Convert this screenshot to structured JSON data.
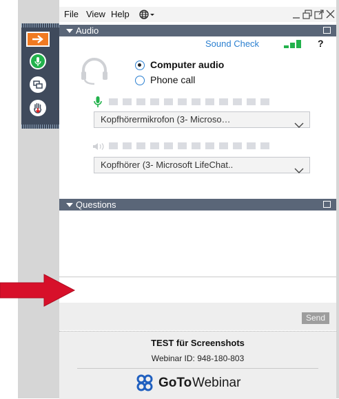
{
  "menubar": {
    "items": [
      "File",
      "View",
      "Help"
    ],
    "window_controls": [
      "minimize",
      "restore",
      "popout",
      "close"
    ]
  },
  "audio": {
    "header": "Audio",
    "sound_check_label": "Sound Check",
    "help_label": "?",
    "options": [
      {
        "label": "Computer audio",
        "selected": true
      },
      {
        "label": "Phone call",
        "selected": false
      }
    ],
    "microphone": {
      "device": "Kopfhörermikrofon (3- Microso…",
      "level_segments_total": 12
    },
    "speaker": {
      "device": "Kopfhörer (3- Microsoft LifeChat..",
      "level_segments_total": 12
    }
  },
  "questions": {
    "header": "Questions",
    "input_value": "",
    "send_label": "Send"
  },
  "footer": {
    "webinar_title": "TEST für Screenshots",
    "webinar_id": "Webinar ID: 948-180-803",
    "brand_prefix": "GoTo",
    "brand_suffix": "Webinar"
  },
  "colors": {
    "header_bar": "#5a6678",
    "rail_bg": "#3f4a5c",
    "accent_orange": "#f07a22",
    "accent_green": "#22b24c",
    "link_blue": "#2a7fd0",
    "annotation_arrow": "#d7102a"
  }
}
